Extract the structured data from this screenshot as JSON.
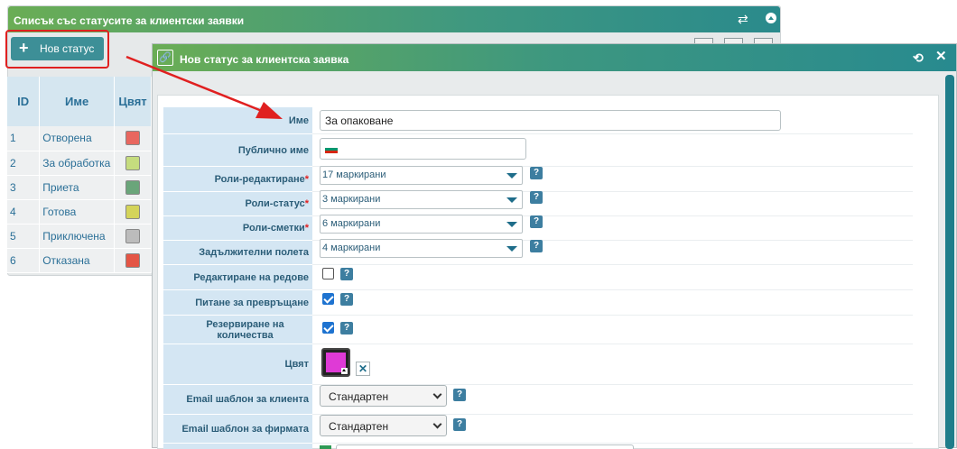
{
  "back_panel": {
    "title": "Списък със статусите за клиентски заявки",
    "new_button_label": "Нов статус",
    "table": {
      "headers": [
        "ID",
        "Име",
        "Цвят"
      ],
      "rows": [
        {
          "id": "1",
          "name": "Отворена",
          "color": "#e8675f"
        },
        {
          "id": "2",
          "name": "За обработка",
          "color": "#c5dc7e"
        },
        {
          "id": "3",
          "name": "Приета",
          "color": "#6aa57a"
        },
        {
          "id": "4",
          "name": "Готова",
          "color": "#d4d45a"
        },
        {
          "id": "5",
          "name": "Приключена",
          "color": "#bcbcbc"
        },
        {
          "id": "6",
          "name": "Отказана",
          "color": "#e45545"
        }
      ]
    }
  },
  "modal": {
    "title": "Нов статус за клиентска заявка",
    "fields": {
      "name_label": "Име",
      "name_value": "За опаковане",
      "public_name_label": "Публично име",
      "public_name_value": "",
      "roles_edit_label": "Роли-редактиране",
      "roles_edit_value": "17 маркирани",
      "roles_status_label": "Роли-статус",
      "roles_status_value": "3 маркирани",
      "roles_bills_label": "Роли-сметки",
      "roles_bills_value": "6 маркирани",
      "required_fields_label": "Задължителни полета",
      "required_fields_value": "4 маркирани",
      "edit_rows_label": "Редактиране на редове",
      "ask_convert_label": "Питане за превръщане",
      "reserve_qty_label": "Резервиране на количества",
      "color_label": "Цвят",
      "email_client_label": "Email шаблон за клиента",
      "email_client_value": "Стандартен",
      "email_company_label": "Email шаблон за фирмата",
      "email_company_value": "Стандартен"
    },
    "checkbox_states": {
      "edit_rows": false,
      "ask_convert": true,
      "reserve_qty": true
    },
    "required_marker": "*",
    "help_glyph": "?",
    "clear_glyph": "✕",
    "selected_color": "#df3ad6"
  },
  "colors": {
    "accent": "#3d8f97",
    "annotation_red": "#e02020"
  }
}
